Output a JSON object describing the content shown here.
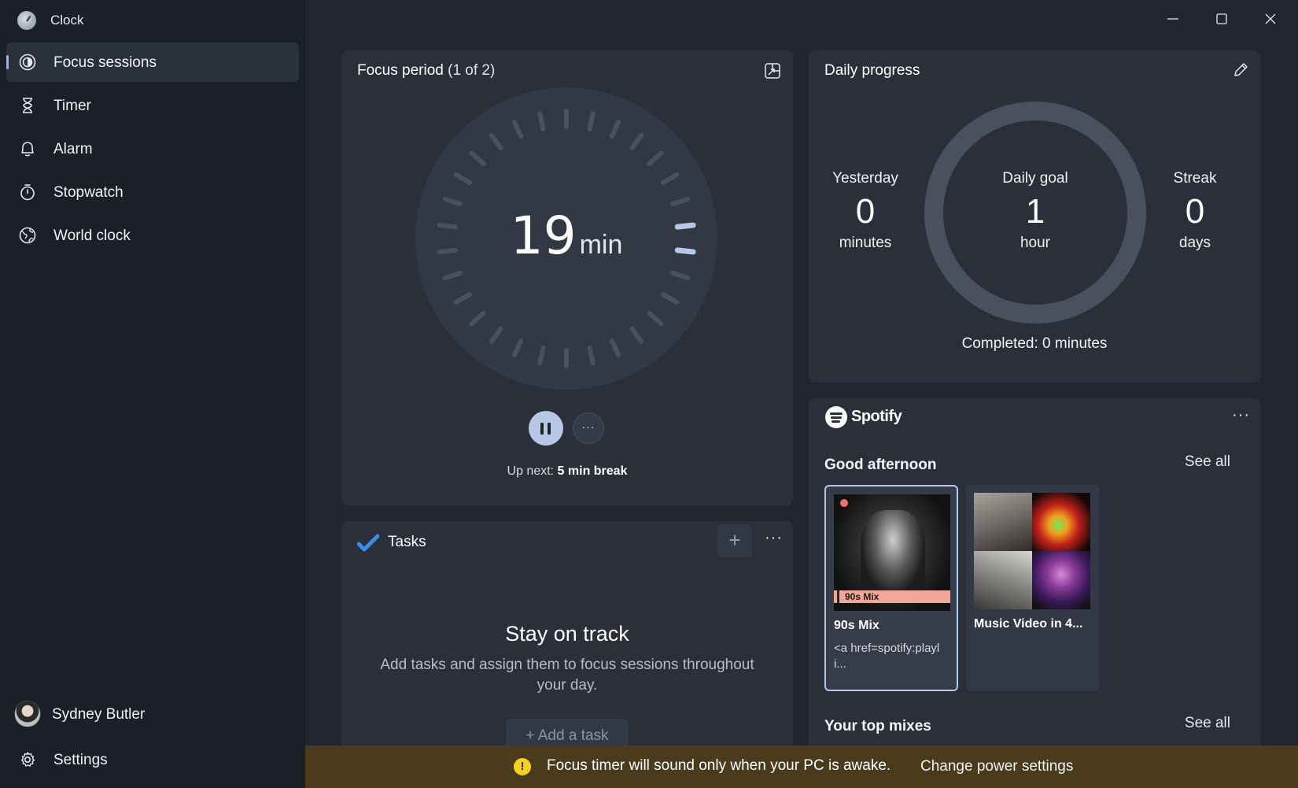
{
  "app": {
    "title": "Clock"
  },
  "sidebar": {
    "items": [
      {
        "label": "Focus sessions",
        "icon": "focus-icon",
        "active": true
      },
      {
        "label": "Timer",
        "icon": "hourglass-icon"
      },
      {
        "label": "Alarm",
        "icon": "bell-icon"
      },
      {
        "label": "Stopwatch",
        "icon": "stopwatch-icon"
      },
      {
        "label": "World clock",
        "icon": "globe-icon"
      }
    ],
    "user": {
      "name": "Sydney Butler"
    },
    "settings_label": "Settings"
  },
  "focus": {
    "title": "Focus period",
    "subtitle": "(1 of 2)",
    "time_value": "19",
    "time_unit": "min",
    "up_next_prefix": "Up next: ",
    "up_next_value": "5 min break",
    "more_label": "···",
    "accent": "#b9c7e6"
  },
  "tasks": {
    "title": "Tasks",
    "add_label": "+",
    "empty_title": "Stay on track",
    "empty_text": "Add tasks and assign them to focus sessions throughout your day.",
    "add_task_label": "+ Add a task"
  },
  "daily": {
    "title": "Daily progress",
    "yesterday": {
      "label": "Yesterday",
      "value": "0",
      "unit": "minutes"
    },
    "goal": {
      "label": "Daily goal",
      "value": "1",
      "unit": "hour"
    },
    "streak": {
      "label": "Streak",
      "value": "0",
      "unit": "days"
    },
    "completed": "Completed: 0 minutes"
  },
  "spotify": {
    "brand": "Spotify",
    "section1": {
      "title": "Good afternoon",
      "see_all": "See all"
    },
    "section2": {
      "title": "Your top mixes",
      "see_all": "See all"
    },
    "tiles": [
      {
        "name": "90s Mix",
        "art_label": "90s Mix",
        "desc": "<a href=spotify:playli..."
      },
      {
        "name": "Music Video in 4...",
        "desc": ""
      }
    ]
  },
  "banner": {
    "icon": "!",
    "text": "Focus timer will sound only when your PC is awake.",
    "link": "Change power settings",
    "color": "#4a3b1d"
  }
}
